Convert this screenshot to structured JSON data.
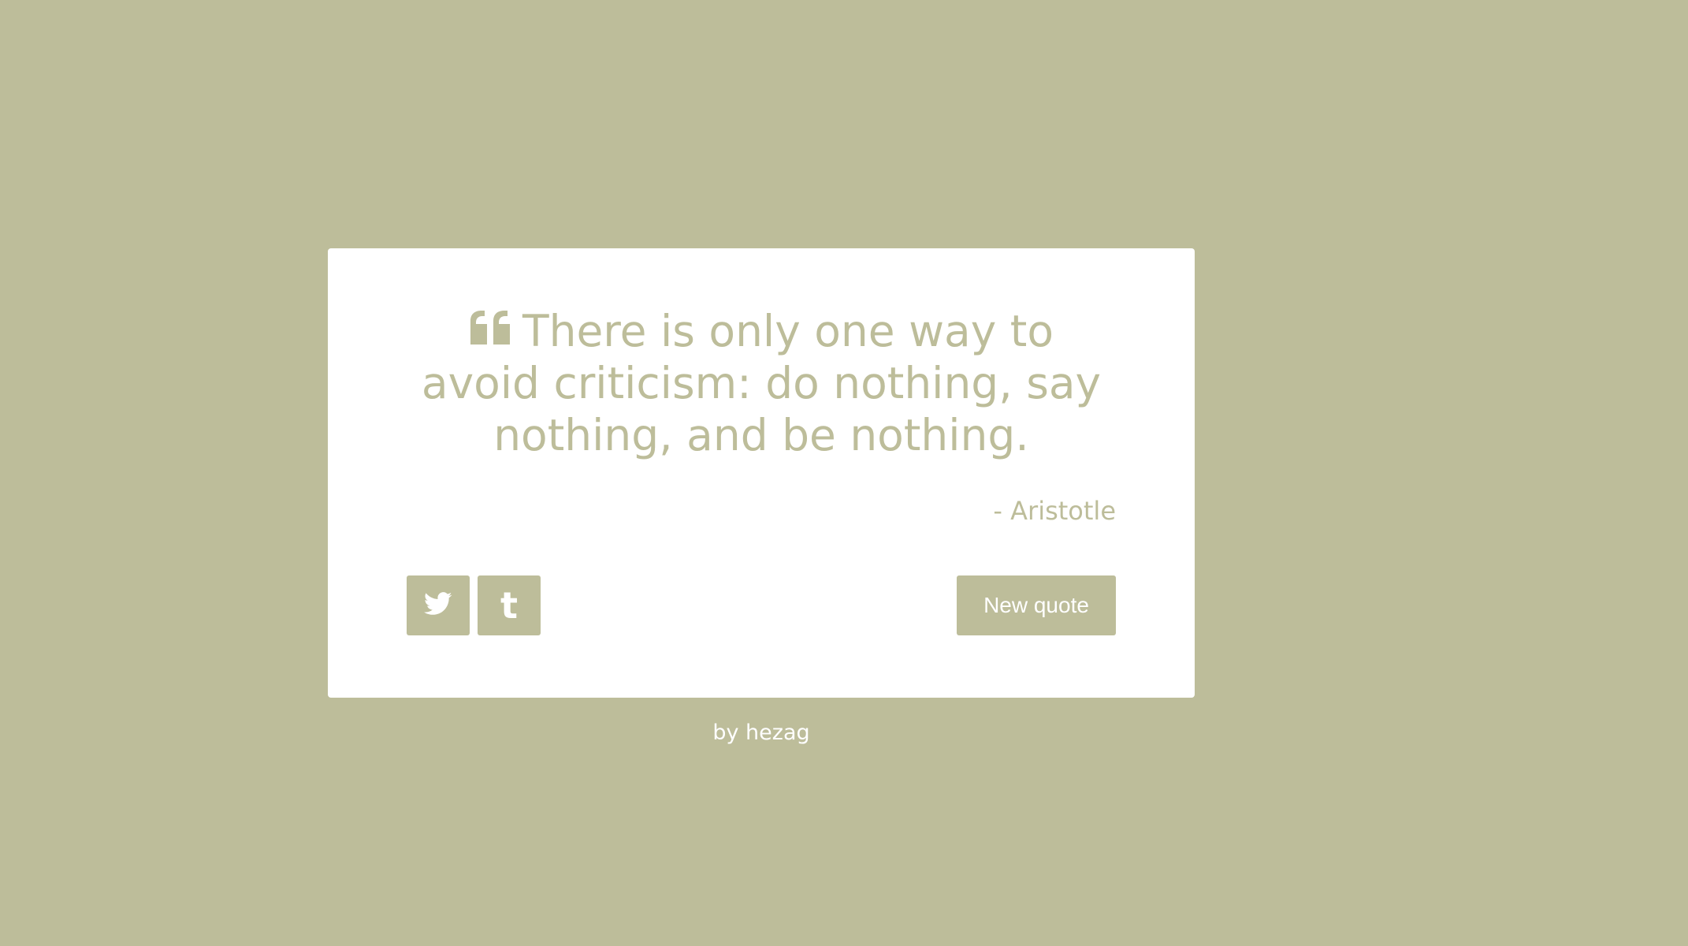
{
  "theme": {
    "background": "#bdbd9a",
    "card": "#ffffff",
    "accent": "#bdbd9a"
  },
  "quote": {
    "icon": "quote-left-icon",
    "text": "There is only one way to avoid criticism: do nothing, say nothing, and be nothing.",
    "author": "- Aristotle"
  },
  "actions": {
    "tweet_icon": "twitter-icon",
    "tumblr_icon": "tumblr-icon",
    "tumblr_glyph": "t",
    "new_quote_label": "New quote"
  },
  "footer": {
    "prefix": "by ",
    "author_link": "hezag"
  }
}
